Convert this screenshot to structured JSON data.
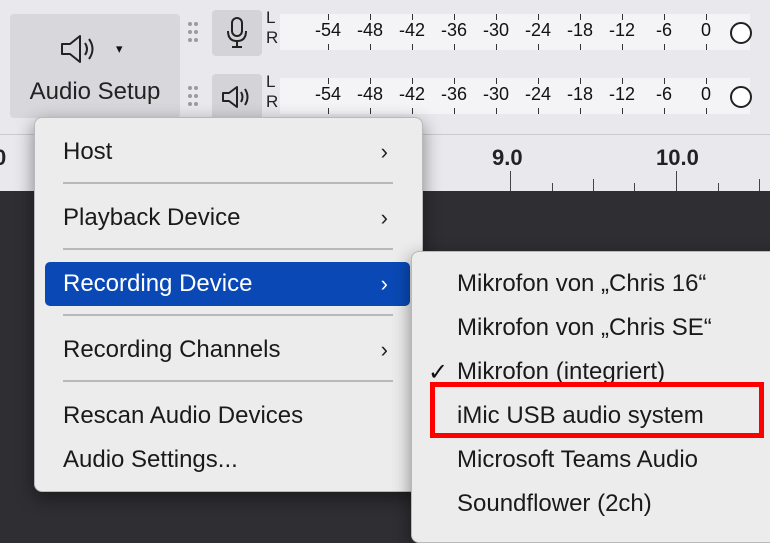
{
  "toolbar": {
    "audio_setup": {
      "label": "Audio Setup",
      "icon": "speaker-icon",
      "caret": "▾"
    },
    "recording_meter": {
      "icon": "microphone-icon",
      "channels": [
        "L",
        "R"
      ],
      "ticks": [
        "-54",
        "-48",
        "-42",
        "-36",
        "-30",
        "-24",
        "-18",
        "-12",
        "-6",
        "0"
      ]
    },
    "playback_meter": {
      "icon": "speaker-icon",
      "channels": [
        "L",
        "R"
      ],
      "ticks": [
        "-54",
        "-48",
        "-42",
        "-36",
        "-30",
        "-24",
        "-18",
        "-12",
        "-6",
        "0"
      ]
    }
  },
  "timeline": {
    "labels": [
      "0",
      "9.0",
      "10.0"
    ]
  },
  "menu": {
    "items": [
      {
        "label": "Host",
        "arrow": "›"
      },
      {
        "label": "Playback Device",
        "arrow": "›"
      },
      {
        "label": "Recording Device",
        "arrow": "›",
        "active": true
      },
      {
        "label": "Recording Channels",
        "arrow": "›"
      },
      {
        "label": "Rescan Audio Devices"
      },
      {
        "label": "Audio Settings..."
      }
    ]
  },
  "submenu": {
    "items": [
      {
        "label": "Mikrofon von „Chris 16“"
      },
      {
        "label": "Mikrofon von „Chris SE“"
      },
      {
        "label": "Mikrofon (integriert)",
        "checked": true,
        "check": "✓"
      },
      {
        "label": "iMic USB audio system",
        "highlighted": true
      },
      {
        "label": "Microsoft Teams Audio"
      },
      {
        "label": "Soundflower (2ch)"
      }
    ]
  },
  "colors": {
    "menu_active": "#0a49b5",
    "annotation_box": "#ff0000",
    "background": "#2f2f33"
  }
}
